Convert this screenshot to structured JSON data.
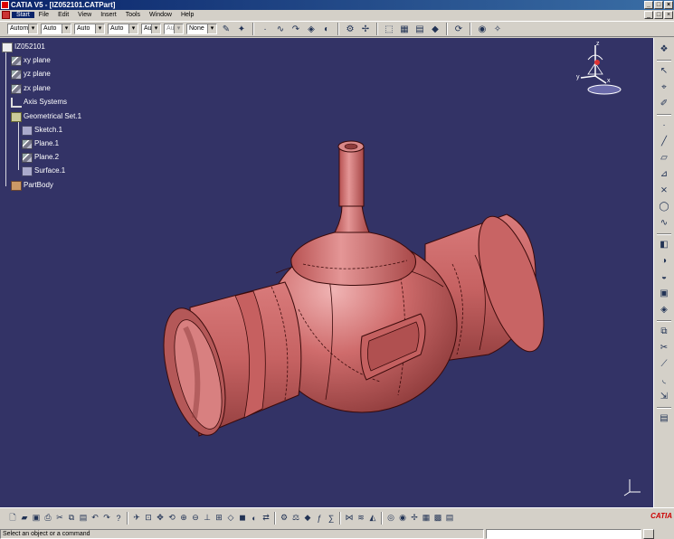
{
  "window": {
    "title": "CATIA V5 - [IZ052101.CATPart]",
    "buttons": [
      "_",
      "□",
      "×"
    ]
  },
  "menubar": {
    "items": [
      "Start",
      "File",
      "Edit",
      "View",
      "Insert",
      "Tools",
      "Window",
      "Help"
    ],
    "active": "Start"
  },
  "toolbar": {
    "combos": [
      "Automo",
      "Auto",
      "Auto",
      "Auto",
      "Aut",
      "Au",
      "None"
    ]
  },
  "tree": {
    "root": "IZ052101",
    "xy_plane": "xy plane",
    "yz_plane": "yz plane",
    "zx_plane": "zx plane",
    "axis_systems": "Axis Systems",
    "geometrical_set": "Geometrical Set.1",
    "sketch": "Sketch.1",
    "plane1": "Plane.1",
    "plane2": "Plane.2",
    "surface": "Surface.1",
    "partbody": "PartBody"
  },
  "compass": {
    "x": "x",
    "y": "y",
    "z": "z"
  },
  "colors": {
    "viewport_bg": "#333366",
    "part_fill": "#c86464",
    "part_shadow": "#8e3c3c",
    "part_highlight": "#e8a0a0",
    "edge": "#3a0a0a"
  },
  "status": {
    "message": "Select an object or a command"
  },
  "logo": "CATIA"
}
